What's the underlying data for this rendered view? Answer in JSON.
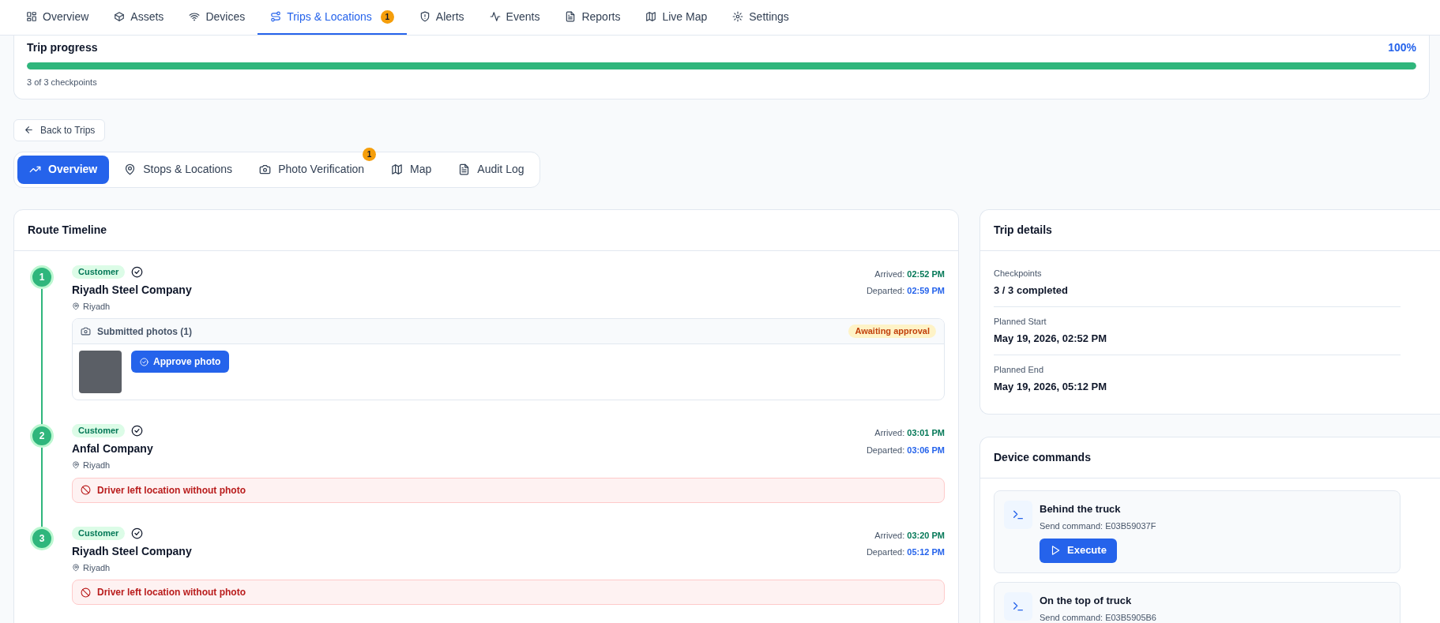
{
  "nav_tabs": [
    {
      "label": "Overview",
      "selected": false
    },
    {
      "label": "Assets",
      "selected": false
    },
    {
      "label": "Devices",
      "selected": false
    },
    {
      "label": "Trips & Locations",
      "selected": true,
      "badge": "1"
    },
    {
      "label": "Alerts",
      "selected": false
    },
    {
      "label": "Events",
      "selected": false
    },
    {
      "label": "Reports",
      "selected": false
    },
    {
      "label": "Live Map",
      "selected": false
    },
    {
      "label": "Settings",
      "selected": false
    }
  ],
  "trip_progress": {
    "title": "Trip progress",
    "percent": "100%",
    "level": 1.0,
    "caption": "3 of 3 checkpoints"
  },
  "back_button": "Back to Trips",
  "sub_tabs": [
    {
      "label": "Overview",
      "selected": true
    },
    {
      "label": "Stops & Locations",
      "selected": false
    },
    {
      "label": "Photo Verification",
      "selected": false,
      "badge": "1"
    },
    {
      "label": "Map",
      "selected": false
    },
    {
      "label": "Audit Log",
      "selected": false
    }
  ],
  "route_timeline": {
    "title": "Route Timeline",
    "stops": [
      {
        "number": "1",
        "tag": "Customer",
        "completed": true,
        "name": "Riyadh Steel Company",
        "city": "Riyadh",
        "arrived_label": "Arrived:",
        "arrived": "02:52 PM",
        "departed_label": "Departed:",
        "departed": "02:59 PM",
        "kind": "photos",
        "photos_title": "Submitted photos (1)",
        "status": "Awaiting approval",
        "action": "Approve photo"
      },
      {
        "number": "2",
        "tag": "Customer",
        "completed": true,
        "name": "Anfal Company",
        "city": "Riyadh",
        "arrived_label": "Arrived:",
        "arrived": "03:01 PM",
        "departed_label": "Departed:",
        "departed": "03:06 PM",
        "kind": "alert",
        "message": "Driver left location without photo"
      },
      {
        "number": "3",
        "tag": "Customer",
        "completed": true,
        "name": "Riyadh Steel Company",
        "city": "Riyadh",
        "arrived_label": "Arrived:",
        "arrived": "03:20 PM",
        "departed_label": "Departed:",
        "departed": "05:12 PM",
        "kind": "alert",
        "message": "Driver left location without photo"
      }
    ]
  },
  "trip_details": {
    "title": "Trip details",
    "fields": [
      {
        "label": "Checkpoints",
        "value": "3 / 3 completed"
      },
      {
        "label": "Planned Start",
        "value": "May 19, 2026, 02:52 PM"
      },
      {
        "label": "Planned End",
        "value": "May 19, 2026, 05:12 PM"
      }
    ]
  },
  "device_commands": {
    "title": "Device commands",
    "commands": [
      {
        "name": "Behind the truck",
        "detail": "Send command: E03B59037F",
        "action": "Execute"
      },
      {
        "name": "On the top of truck",
        "detail": "Send command: E03B5905B6"
      }
    ]
  }
}
